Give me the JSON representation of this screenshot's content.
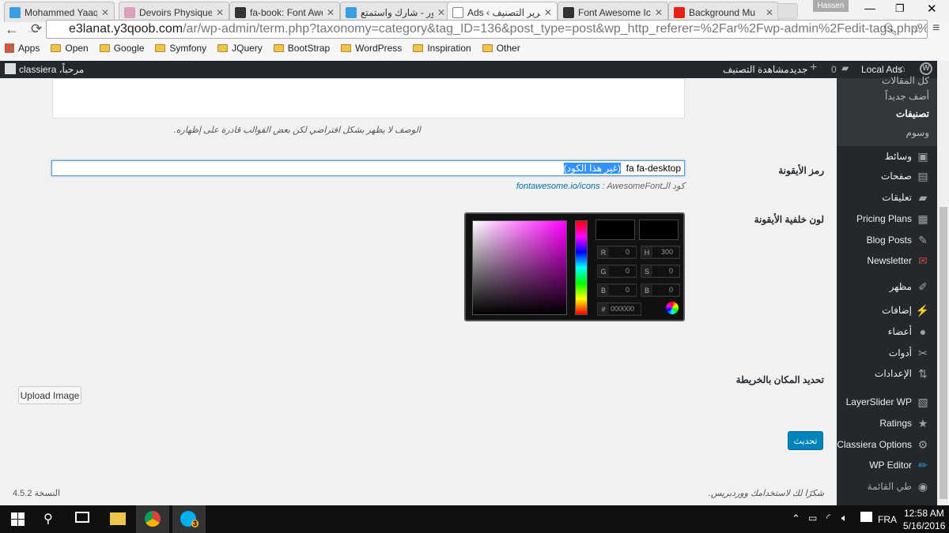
{
  "browser": {
    "tabs": [
      {
        "title": "Mohammed Yaaqo",
        "color": "#3aa0e0"
      },
      {
        "title": "Devoirs Physique -",
        "color": "#d9a0c0"
      },
      {
        "title": "fa-book: Font Awes",
        "color": "#333333"
      },
      {
        "title": "صور - شارك واستمتع",
        "color": "#3aa0e0"
      },
      {
        "title": "Ads ‹ تحرير التصنيف",
        "color": "#ffffff",
        "active": true
      },
      {
        "title": "Font Awesome Icon",
        "color": "#333333"
      },
      {
        "title": "Background Mu",
        "color": "#e62117"
      }
    ],
    "close_glyph": "✕",
    "profile": "Hassen",
    "url_host": "e3lanat.y3qoob.com",
    "url_path": "/ar/wp-admin/term.php?taxonomy=category&tag_ID=136&post_type=post&wp_http_referer=%2Far%2Fwp-admin%2Fedit-tags.php%3Ftaxor",
    "bookmarks": [
      "Apps",
      "Open",
      "Google",
      "Symfony",
      "JQuery",
      "BootStrap",
      "WordPress",
      "Inspiration",
      "Other"
    ]
  },
  "adminbar": {
    "greeting": "مرحباً، classiera",
    "site": "Local Ads",
    "comments": "0",
    "new": "جديد",
    "view": "مشاهدة التصنيف"
  },
  "sidebar": {
    "submenu": [
      "كل المقالات",
      "أضف جديداً",
      "تصنيفات",
      "وسوم"
    ],
    "items": [
      {
        "label": "وسائط",
        "icon": "media-icon"
      },
      {
        "label": "صفحات",
        "icon": "pages-icon"
      },
      {
        "label": "تعليقات",
        "icon": "comments-icon"
      },
      {
        "label": "Pricing Plans",
        "icon": "pricing-icon"
      },
      {
        "label": "Blog Posts",
        "icon": "pin-icon"
      },
      {
        "label": "Newsletter",
        "icon": "mail-icon"
      },
      {
        "label": "مظهر",
        "icon": "appearance-icon"
      },
      {
        "label": "إضافات",
        "icon": "plugins-icon"
      },
      {
        "label": "أعضاء",
        "icon": "users-icon"
      },
      {
        "label": "أدوات",
        "icon": "tools-icon"
      },
      {
        "label": "الإعدادات",
        "icon": "settings-icon"
      },
      {
        "label": "LayerSlider WP",
        "icon": "layerslider-icon"
      },
      {
        "label": "Ratings",
        "icon": "star-icon"
      },
      {
        "label": "Classiera Options",
        "icon": "gear-icon"
      },
      {
        "label": "WP Editor",
        "icon": "pencil-icon"
      },
      {
        "label": "طي القائمة",
        "icon": "collapse-icon"
      }
    ]
  },
  "form": {
    "description_hint": "الوصف لا يظهر بشكل افتراضي لكن بعض القوالب قادرة على إظهاره.",
    "icon_label": "رمز الأيقونة",
    "icon_value": "fa fa-desktop",
    "icon_selected": "(غير هذا الكود)",
    "icon_hint_prefix": "كود الـ",
    "icon_hint_link": "fontawesome.io/icons",
    "icon_hint_suffix": " : AwesomeFont",
    "bg_label": "لون خلفية الأيقونة",
    "picker": {
      "R": "0",
      "G": "0",
      "B": "0",
      "H": "300",
      "S": "0",
      "Bv": "0",
      "hex": "000000"
    },
    "map_label": "تحديد المكان بالخريطة",
    "upload": "Upload Image",
    "update": "تحديث"
  },
  "footer": {
    "thanks": "شكرًا لك لاستخدامك ووردبريس.",
    "version": "النسخة 4.5.2"
  },
  "taskbar": {
    "lang": "FRA",
    "time": "12:58 AM",
    "date": "5/16/2016",
    "skype_badge": "3"
  }
}
